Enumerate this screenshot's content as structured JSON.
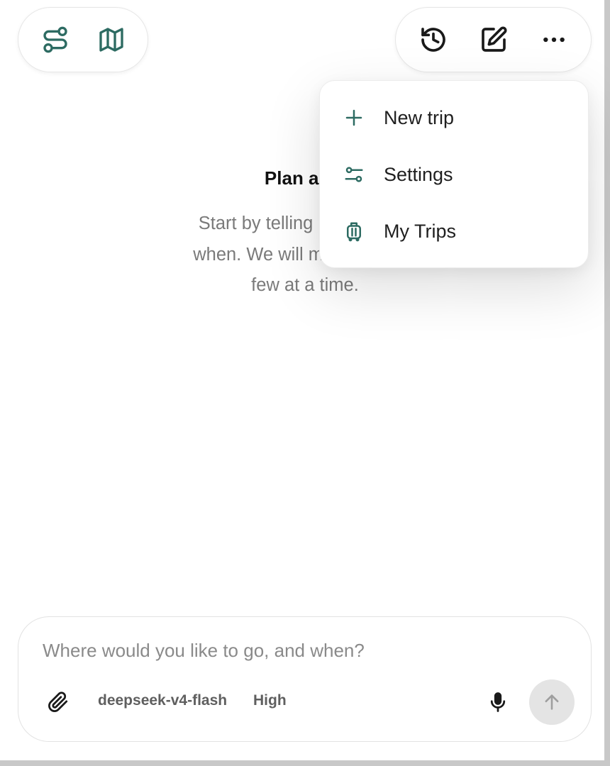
{
  "colors": {
    "accent": "#2d6b62",
    "text_muted": "#7a7a7a",
    "send_disabled": "#e4e4e4"
  },
  "toolbar_left": {
    "icons": [
      "route-icon",
      "map-icon"
    ]
  },
  "toolbar_right": {
    "icons": [
      "history-icon",
      "edit-icon",
      "more-icon"
    ]
  },
  "hero": {
    "title": "Plan a ne",
    "sub_line1": "Start by telling me where y",
    "sub_line2": "when. We will make the imp",
    "sub_line3": "few at a time."
  },
  "menu": {
    "items": [
      {
        "label": "New trip",
        "icon": "plus-icon"
      },
      {
        "label": "Settings",
        "icon": "settings-sliders-icon"
      },
      {
        "label": "My Trips",
        "icon": "luggage-icon"
      }
    ]
  },
  "composer": {
    "placeholder": "Where would you like to go, and when?",
    "model": "deepseek-v4-flash",
    "effort": "High"
  }
}
